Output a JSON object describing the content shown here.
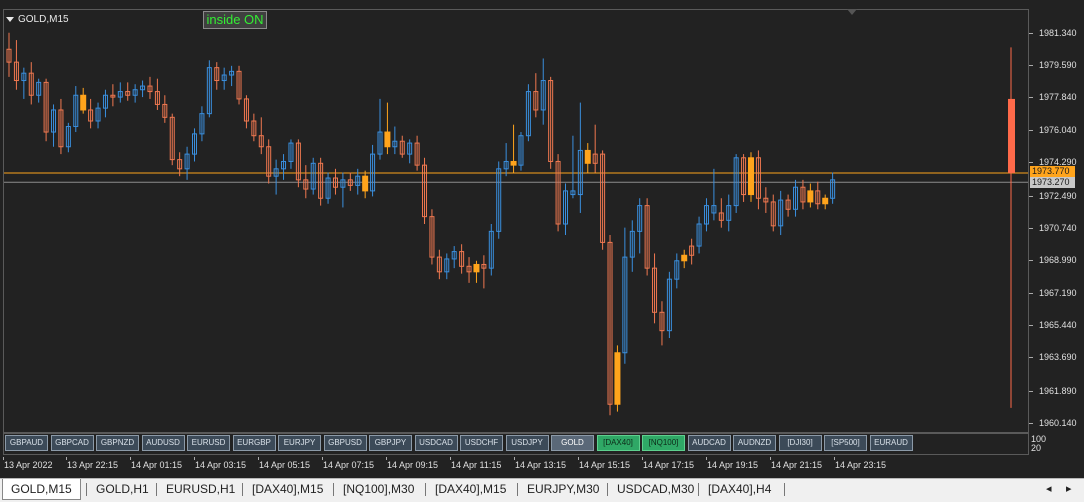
{
  "window": {
    "title": "GOLD,M15",
    "inside_label": "inside ON",
    "price_labels": [
      "1981.340",
      "1979.590",
      "1977.840",
      "1976.040",
      "1974.290",
      "1972.490",
      "1970.740",
      "1968.990",
      "1967.190",
      "1965.440",
      "1963.690",
      "1961.890",
      "1960.140"
    ],
    "ask_price": "1973.770",
    "bid_price": "1973.270",
    "subwindow_labels": [
      "100",
      "20"
    ],
    "time_labels": [
      "13 Apr 2022",
      "13 Apr 22:15",
      "14 Apr 01:15",
      "14 Apr 03:15",
      "14 Apr 05:15",
      "14 Apr 07:15",
      "14 Apr 09:15",
      "14 Apr 11:15",
      "14 Apr 13:15",
      "14 Apr 15:15",
      "14 Apr 17:15",
      "14 Apr 19:15",
      "14 Apr 21:15",
      "14 Apr 23:15"
    ]
  },
  "symbol_buttons": [
    {
      "label": "GBPAUD",
      "style": "normal"
    },
    {
      "label": "GBPCAD",
      "style": "normal"
    },
    {
      "label": "GBPNZD",
      "style": "normal"
    },
    {
      "label": "AUDUSD",
      "style": "normal"
    },
    {
      "label": "EURUSD",
      "style": "normal"
    },
    {
      "label": "EURGBP",
      "style": "normal"
    },
    {
      "label": "EURJPY",
      "style": "normal"
    },
    {
      "label": "GBPUSD",
      "style": "normal"
    },
    {
      "label": "GBPJPY",
      "style": "normal"
    },
    {
      "label": "USDCAD",
      "style": "normal"
    },
    {
      "label": "USDCHF",
      "style": "normal"
    },
    {
      "label": "USDJPY",
      "style": "normal"
    },
    {
      "label": "GOLD",
      "style": "active"
    },
    {
      "label": "[DAX40]",
      "style": "green"
    },
    {
      "label": "[NQ100]",
      "style": "green"
    },
    {
      "label": "AUDCAD",
      "style": "normal"
    },
    {
      "label": "AUDNZD",
      "style": "normal"
    },
    {
      "label": "[DJI30]",
      "style": "normal"
    },
    {
      "label": "[SP500]",
      "style": "normal"
    },
    {
      "label": "EURAUD",
      "style": "normal"
    }
  ],
  "tabs": [
    {
      "label": "GOLD,M15",
      "active": true
    },
    {
      "label": "GOLD,H1",
      "active": false
    },
    {
      "label": "EURUSD,H1",
      "active": false
    },
    {
      "label": "[DAX40],M15",
      "active": false
    },
    {
      "label": "[NQ100],M30",
      "active": false
    },
    {
      "label": "[DAX40],M15",
      "active": false
    },
    {
      "label": "EURJPY,M30",
      "active": false
    },
    {
      "label": "USDCAD,M30",
      "active": false
    },
    {
      "label": "[DAX40],H4",
      "active": false
    }
  ],
  "colors": {
    "bull": "#3a8fde",
    "bear": "#f07850",
    "inside": "#ffa41c",
    "ask_line": "#ffa41c",
    "bid_line": "#8c8c8c",
    "current_bar": "#ff6a4a"
  },
  "chart_data": {
    "type": "candlestick",
    "symbol": "GOLD",
    "timeframe": "M15",
    "ylim": [
      1959.8,
      1982.2
    ],
    "ask": 1973.77,
    "bid": 1973.27,
    "candles": [
      {
        "o": 1980.5,
        "h": 1981.4,
        "l": 1979.0,
        "c": 1979.8,
        "t": "bear"
      },
      {
        "o": 1979.8,
        "h": 1981.0,
        "l": 1978.3,
        "c": 1978.8,
        "t": "bear"
      },
      {
        "o": 1978.8,
        "h": 1979.5,
        "l": 1977.8,
        "c": 1979.2,
        "t": "bull"
      },
      {
        "o": 1979.2,
        "h": 1979.8,
        "l": 1977.5,
        "c": 1978.0,
        "t": "bear"
      },
      {
        "o": 1978.0,
        "h": 1978.9,
        "l": 1977.6,
        "c": 1978.7,
        "t": "bull"
      },
      {
        "o": 1978.7,
        "h": 1978.9,
        "l": 1975.5,
        "c": 1976.0,
        "t": "bear"
      },
      {
        "o": 1976.0,
        "h": 1977.5,
        "l": 1975.2,
        "c": 1977.2,
        "t": "bull"
      },
      {
        "o": 1977.2,
        "h": 1977.8,
        "l": 1974.8,
        "c": 1975.2,
        "t": "bear"
      },
      {
        "o": 1975.2,
        "h": 1976.5,
        "l": 1974.9,
        "c": 1976.3,
        "t": "bull"
      },
      {
        "o": 1976.3,
        "h": 1978.5,
        "l": 1976.0,
        "c": 1978.0,
        "t": "bull"
      },
      {
        "o": 1978.0,
        "h": 1978.4,
        "l": 1977.0,
        "c": 1977.2,
        "t": "inside"
      },
      {
        "o": 1977.2,
        "h": 1977.8,
        "l": 1976.2,
        "c": 1976.6,
        "t": "bear"
      },
      {
        "o": 1976.6,
        "h": 1977.6,
        "l": 1976.2,
        "c": 1977.3,
        "t": "bull"
      },
      {
        "o": 1977.3,
        "h": 1978.3,
        "l": 1976.8,
        "c": 1978.0,
        "t": "bull"
      },
      {
        "o": 1978.0,
        "h": 1978.6,
        "l": 1977.4,
        "c": 1977.9,
        "t": "bear"
      },
      {
        "o": 1977.9,
        "h": 1978.7,
        "l": 1977.6,
        "c": 1978.2,
        "t": "bull"
      },
      {
        "o": 1978.2,
        "h": 1978.7,
        "l": 1977.7,
        "c": 1978.0,
        "t": "bear"
      },
      {
        "o": 1978.0,
        "h": 1978.6,
        "l": 1977.6,
        "c": 1978.3,
        "t": "bull"
      },
      {
        "o": 1978.3,
        "h": 1978.8,
        "l": 1977.9,
        "c": 1978.5,
        "t": "bull"
      },
      {
        "o": 1978.5,
        "h": 1979.0,
        "l": 1977.8,
        "c": 1978.2,
        "t": "bear"
      },
      {
        "o": 1978.2,
        "h": 1978.9,
        "l": 1977.2,
        "c": 1977.5,
        "t": "bear"
      },
      {
        "o": 1977.5,
        "h": 1978.0,
        "l": 1976.5,
        "c": 1976.8,
        "t": "bear"
      },
      {
        "o": 1976.8,
        "h": 1977.0,
        "l": 1974.2,
        "c": 1974.5,
        "t": "bear"
      },
      {
        "o": 1974.5,
        "h": 1974.9,
        "l": 1973.6,
        "c": 1974.0,
        "t": "bear"
      },
      {
        "o": 1974.0,
        "h": 1975.2,
        "l": 1973.4,
        "c": 1974.8,
        "t": "bull"
      },
      {
        "o": 1974.8,
        "h": 1976.2,
        "l": 1974.4,
        "c": 1975.9,
        "t": "bull"
      },
      {
        "o": 1975.9,
        "h": 1977.4,
        "l": 1975.5,
        "c": 1977.0,
        "t": "bull"
      },
      {
        "o": 1977.0,
        "h": 1979.9,
        "l": 1976.8,
        "c": 1979.5,
        "t": "bull"
      },
      {
        "o": 1979.5,
        "h": 1979.8,
        "l": 1978.3,
        "c": 1978.8,
        "t": "bear"
      },
      {
        "o": 1978.8,
        "h": 1979.5,
        "l": 1978.3,
        "c": 1979.1,
        "t": "bull"
      },
      {
        "o": 1979.1,
        "h": 1979.6,
        "l": 1978.5,
        "c": 1979.3,
        "t": "bull"
      },
      {
        "o": 1979.3,
        "h": 1979.6,
        "l": 1977.5,
        "c": 1977.8,
        "t": "bear"
      },
      {
        "o": 1977.8,
        "h": 1978.0,
        "l": 1976.2,
        "c": 1976.6,
        "t": "bear"
      },
      {
        "o": 1976.6,
        "h": 1977.0,
        "l": 1975.5,
        "c": 1975.8,
        "t": "bear"
      },
      {
        "o": 1975.8,
        "h": 1976.8,
        "l": 1974.8,
        "c": 1975.2,
        "t": "bear"
      },
      {
        "o": 1975.2,
        "h": 1975.6,
        "l": 1973.2,
        "c": 1973.6,
        "t": "bear"
      },
      {
        "o": 1973.6,
        "h": 1974.5,
        "l": 1972.6,
        "c": 1974.0,
        "t": "bull"
      },
      {
        "o": 1974.0,
        "h": 1974.8,
        "l": 1973.4,
        "c": 1974.4,
        "t": "bull"
      },
      {
        "o": 1974.4,
        "h": 1975.6,
        "l": 1974.0,
        "c": 1975.4,
        "t": "bull"
      },
      {
        "o": 1975.4,
        "h": 1975.6,
        "l": 1973.0,
        "c": 1973.4,
        "t": "bear"
      },
      {
        "o": 1973.4,
        "h": 1974.2,
        "l": 1972.4,
        "c": 1972.9,
        "t": "bear"
      },
      {
        "o": 1972.9,
        "h": 1974.6,
        "l": 1972.6,
        "c": 1974.3,
        "t": "bull"
      },
      {
        "o": 1974.3,
        "h": 1974.6,
        "l": 1972.0,
        "c": 1972.4,
        "t": "bear"
      },
      {
        "o": 1972.4,
        "h": 1973.8,
        "l": 1972.1,
        "c": 1973.5,
        "t": "bull"
      },
      {
        "o": 1973.5,
        "h": 1974.0,
        "l": 1972.6,
        "c": 1973.0,
        "t": "bear"
      },
      {
        "o": 1973.0,
        "h": 1973.8,
        "l": 1971.9,
        "c": 1973.4,
        "t": "bull"
      },
      {
        "o": 1973.4,
        "h": 1973.8,
        "l": 1972.8,
        "c": 1973.1,
        "t": "bear"
      },
      {
        "o": 1973.1,
        "h": 1974.0,
        "l": 1972.6,
        "c": 1973.6,
        "t": "bull"
      },
      {
        "o": 1973.6,
        "h": 1973.9,
        "l": 1972.4,
        "c": 1972.8,
        "t": "inside"
      },
      {
        "o": 1972.8,
        "h": 1975.3,
        "l": 1972.5,
        "c": 1974.8,
        "t": "bull"
      },
      {
        "o": 1974.8,
        "h": 1977.8,
        "l": 1974.5,
        "c": 1976.0,
        "t": "bull"
      },
      {
        "o": 1976.0,
        "h": 1977.6,
        "l": 1974.8,
        "c": 1975.2,
        "t": "inside"
      },
      {
        "o": 1975.2,
        "h": 1976.3,
        "l": 1974.8,
        "c": 1975.5,
        "t": "bull"
      },
      {
        "o": 1975.5,
        "h": 1975.8,
        "l": 1974.6,
        "c": 1974.8,
        "t": "bear"
      },
      {
        "o": 1974.8,
        "h": 1975.6,
        "l": 1974.3,
        "c": 1975.4,
        "t": "bull"
      },
      {
        "o": 1975.4,
        "h": 1975.8,
        "l": 1973.9,
        "c": 1974.2,
        "t": "bear"
      },
      {
        "o": 1974.2,
        "h": 1974.6,
        "l": 1971.0,
        "c": 1971.4,
        "t": "bear"
      },
      {
        "o": 1971.4,
        "h": 1971.8,
        "l": 1968.8,
        "c": 1969.2,
        "t": "bear"
      },
      {
        "o": 1969.2,
        "h": 1969.6,
        "l": 1968.0,
        "c": 1968.4,
        "t": "bear"
      },
      {
        "o": 1968.4,
        "h": 1969.4,
        "l": 1968.0,
        "c": 1969.1,
        "t": "bull"
      },
      {
        "o": 1969.1,
        "h": 1969.8,
        "l": 1968.6,
        "c": 1969.5,
        "t": "bull"
      },
      {
        "o": 1969.5,
        "h": 1969.9,
        "l": 1968.3,
        "c": 1968.7,
        "t": "bear"
      },
      {
        "o": 1968.7,
        "h": 1969.2,
        "l": 1967.8,
        "c": 1968.4,
        "t": "bear"
      },
      {
        "o": 1968.4,
        "h": 1969.0,
        "l": 1967.8,
        "c": 1968.8,
        "t": "inside"
      },
      {
        "o": 1968.8,
        "h": 1969.3,
        "l": 1967.5,
        "c": 1968.6,
        "t": "bear"
      },
      {
        "o": 1968.6,
        "h": 1971.0,
        "l": 1968.2,
        "c": 1970.6,
        "t": "bull"
      },
      {
        "o": 1970.6,
        "h": 1974.4,
        "l": 1970.2,
        "c": 1974.0,
        "t": "bull"
      },
      {
        "o": 1974.0,
        "h": 1975.4,
        "l": 1973.6,
        "c": 1974.4,
        "t": "bull"
      },
      {
        "o": 1974.4,
        "h": 1976.4,
        "l": 1973.8,
        "c": 1974.2,
        "t": "inside"
      },
      {
        "o": 1974.2,
        "h": 1976.0,
        "l": 1973.9,
        "c": 1975.8,
        "t": "bull"
      },
      {
        "o": 1975.8,
        "h": 1978.6,
        "l": 1975.5,
        "c": 1978.2,
        "t": "bull"
      },
      {
        "o": 1978.2,
        "h": 1979.2,
        "l": 1976.8,
        "c": 1977.2,
        "t": "bear"
      },
      {
        "o": 1977.2,
        "h": 1980.0,
        "l": 1976.4,
        "c": 1978.8,
        "t": "bull"
      },
      {
        "o": 1978.8,
        "h": 1979.0,
        "l": 1974.0,
        "c": 1974.4,
        "t": "bear"
      },
      {
        "o": 1974.4,
        "h": 1974.8,
        "l": 1970.6,
        "c": 1971.0,
        "t": "bear"
      },
      {
        "o": 1971.0,
        "h": 1973.2,
        "l": 1970.4,
        "c": 1972.8,
        "t": "bull"
      },
      {
        "o": 1972.8,
        "h": 1975.8,
        "l": 1972.4,
        "c": 1972.6,
        "t": "bull"
      },
      {
        "o": 1972.6,
        "h": 1977.6,
        "l": 1971.6,
        "c": 1975.0,
        "t": "bull"
      },
      {
        "o": 1975.0,
        "h": 1975.4,
        "l": 1973.8,
        "c": 1974.3,
        "t": "inside"
      },
      {
        "o": 1974.3,
        "h": 1976.4,
        "l": 1973.8,
        "c": 1974.8,
        "t": "bear"
      },
      {
        "o": 1974.8,
        "h": 1975.0,
        "l": 1969.6,
        "c": 1970.0,
        "t": "bear"
      },
      {
        "o": 1970.0,
        "h": 1970.4,
        "l": 1960.6,
        "c": 1961.2,
        "t": "bear"
      },
      {
        "o": 1961.2,
        "h": 1964.4,
        "l": 1960.8,
        "c": 1964.0,
        "t": "inside"
      },
      {
        "o": 1964.0,
        "h": 1970.8,
        "l": 1963.4,
        "c": 1969.2,
        "t": "bull"
      },
      {
        "o": 1969.2,
        "h": 1971.2,
        "l": 1968.4,
        "c": 1970.6,
        "t": "bull"
      },
      {
        "o": 1970.6,
        "h": 1972.4,
        "l": 1969.4,
        "c": 1972.0,
        "t": "bull"
      },
      {
        "o": 1972.0,
        "h": 1972.4,
        "l": 1968.2,
        "c": 1968.6,
        "t": "bear"
      },
      {
        "o": 1968.6,
        "h": 1969.4,
        "l": 1965.6,
        "c": 1966.2,
        "t": "bear"
      },
      {
        "o": 1966.2,
        "h": 1966.8,
        "l": 1964.4,
        "c": 1965.2,
        "t": "bear"
      },
      {
        "o": 1965.2,
        "h": 1968.4,
        "l": 1964.8,
        "c": 1968.0,
        "t": "bull"
      },
      {
        "o": 1968.0,
        "h": 1969.4,
        "l": 1967.5,
        "c": 1969.0,
        "t": "bull"
      },
      {
        "o": 1969.0,
        "h": 1969.6,
        "l": 1968.6,
        "c": 1969.3,
        "t": "inside"
      },
      {
        "o": 1969.3,
        "h": 1970.2,
        "l": 1968.8,
        "c": 1969.8,
        "t": "bear"
      },
      {
        "o": 1969.8,
        "h": 1971.4,
        "l": 1969.4,
        "c": 1971.0,
        "t": "bull"
      },
      {
        "o": 1971.0,
        "h": 1972.4,
        "l": 1970.6,
        "c": 1972.0,
        "t": "bull"
      },
      {
        "o": 1972.0,
        "h": 1974.0,
        "l": 1971.2,
        "c": 1971.6,
        "t": "bull"
      },
      {
        "o": 1971.6,
        "h": 1972.4,
        "l": 1970.8,
        "c": 1971.2,
        "t": "bear"
      },
      {
        "o": 1971.2,
        "h": 1972.6,
        "l": 1970.6,
        "c": 1972.0,
        "t": "bull"
      },
      {
        "o": 1972.0,
        "h": 1974.8,
        "l": 1971.6,
        "c": 1974.6,
        "t": "bull"
      },
      {
        "o": 1974.6,
        "h": 1974.8,
        "l": 1972.2,
        "c": 1972.6,
        "t": "bear"
      },
      {
        "o": 1972.6,
        "h": 1974.9,
        "l": 1972.2,
        "c": 1974.6,
        "t": "inside"
      },
      {
        "o": 1974.6,
        "h": 1975.0,
        "l": 1971.8,
        "c": 1972.4,
        "t": "bear"
      },
      {
        "o": 1972.4,
        "h": 1973.0,
        "l": 1971.6,
        "c": 1972.2,
        "t": "bear"
      },
      {
        "o": 1972.2,
        "h": 1972.6,
        "l": 1970.6,
        "c": 1970.9,
        "t": "bear"
      },
      {
        "o": 1970.9,
        "h": 1972.8,
        "l": 1970.4,
        "c": 1972.3,
        "t": "bull"
      },
      {
        "o": 1972.3,
        "h": 1972.6,
        "l": 1971.4,
        "c": 1971.8,
        "t": "bear"
      },
      {
        "o": 1971.8,
        "h": 1973.4,
        "l": 1971.4,
        "c": 1973.0,
        "t": "bull"
      },
      {
        "o": 1973.0,
        "h": 1973.4,
        "l": 1971.8,
        "c": 1972.2,
        "t": "bear"
      },
      {
        "o": 1972.2,
        "h": 1973.2,
        "l": 1971.9,
        "c": 1972.8,
        "t": "inside"
      },
      {
        "o": 1972.8,
        "h": 1973.3,
        "l": 1971.8,
        "c": 1972.1,
        "t": "bear"
      },
      {
        "o": 1972.1,
        "h": 1972.6,
        "l": 1971.8,
        "c": 1972.4,
        "t": "inside"
      },
      {
        "o": 1972.4,
        "h": 1973.8,
        "l": 1972.1,
        "c": 1973.4,
        "t": "bull"
      }
    ],
    "current_bar": {
      "o": 1973.77,
      "h": 1980.6,
      "l": 1961.0,
      "c": 1977.8
    }
  }
}
